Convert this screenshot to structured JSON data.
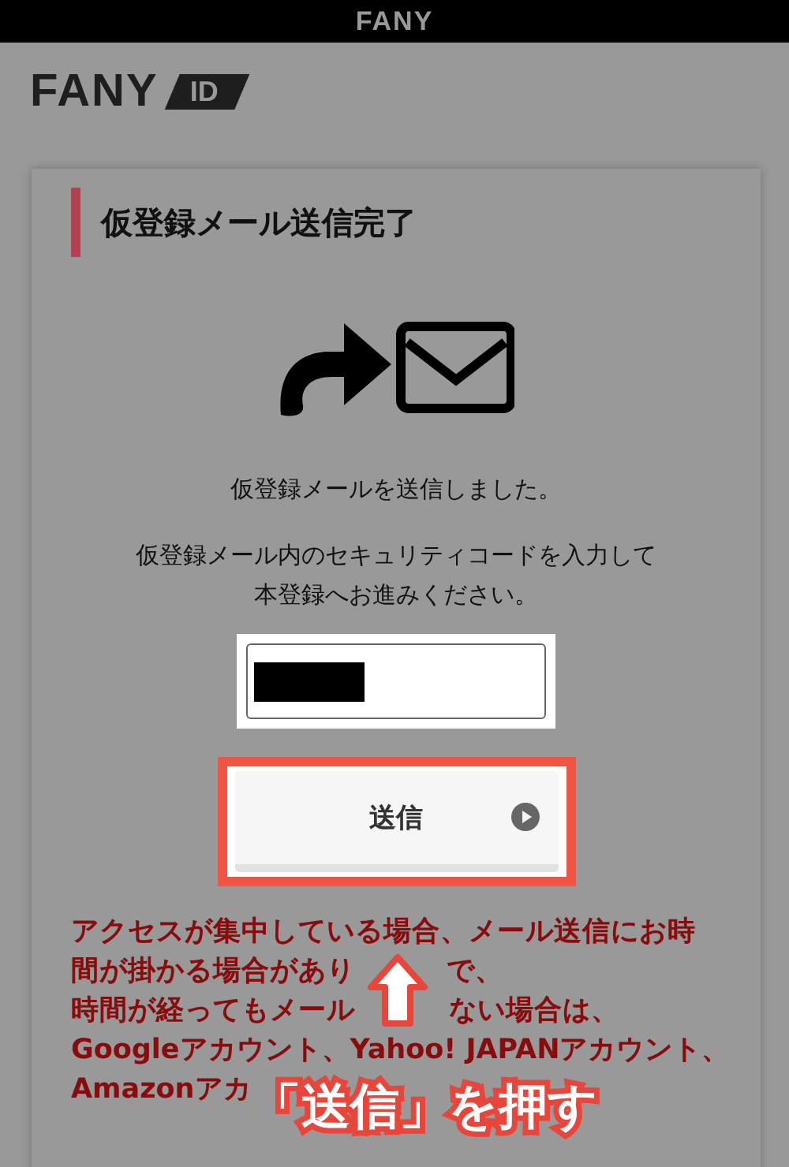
{
  "top_bar": {
    "title": "FANY"
  },
  "logo": {
    "name": "FANY",
    "badge": "ID"
  },
  "card": {
    "title": "仮登録メール送信完了",
    "message": "仮登録メールを送信しました。",
    "instructions": [
      "仮登録メール内のセキュリティコードを入力して",
      "本登録へお進みください。"
    ],
    "code_field": {
      "redacted": true
    },
    "send_button": {
      "label": "送信"
    },
    "notice_lines": [
      {
        "segments": [
          "アクセスが集中している場合、メール送信にお時"
        ]
      },
      {
        "segments": [
          "間が掛かる場合があり",
          "で、"
        ]
      },
      {
        "segments": [
          "時間が経ってもメール",
          "ない場合は、"
        ]
      },
      {
        "segments": [
          "Googleアカウント、Yahoo! JAPANアカウント、"
        ]
      },
      {
        "segments": [
          "Amazonアカ"
        ]
      }
    ]
  },
  "annotation": {
    "label": "「送信」を押す"
  }
}
